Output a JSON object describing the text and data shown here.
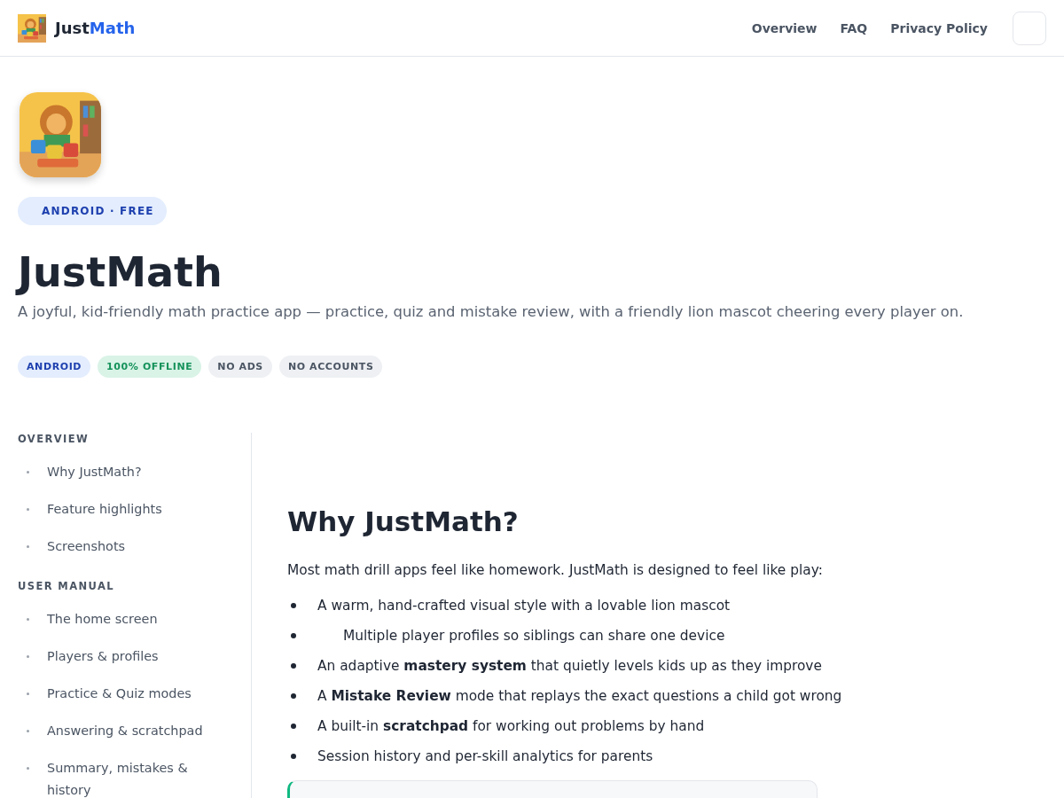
{
  "header": {
    "brand": {
      "first": "Just",
      "second": "Math"
    },
    "nav": [
      {
        "label": "Overview"
      },
      {
        "label": "FAQ"
      },
      {
        "label": "Privacy Policy"
      }
    ]
  },
  "hero": {
    "badge": "ANDROID · FREE",
    "title": "JustMath",
    "subtitle": "A joyful, kid-friendly math practice app — practice, quiz and mistake review, with a friendly lion mascot cheering every player on.",
    "tags": [
      {
        "label": "ANDROID",
        "kind": "primary"
      },
      {
        "label": "100% OFFLINE",
        "kind": "success"
      },
      {
        "label": "NO ADS",
        "kind": "neutral"
      },
      {
        "label": "NO ACCOUNTS",
        "kind": "neutral"
      }
    ]
  },
  "sidebar": {
    "sections": [
      {
        "title": "OVERVIEW",
        "items": [
          {
            "label": "Why JustMath?"
          },
          {
            "label": "Feature highlights"
          },
          {
            "label": "Screenshots"
          }
        ]
      },
      {
        "title": "USER MANUAL",
        "items": [
          {
            "label": "The home screen"
          },
          {
            "label": "Players & profiles"
          },
          {
            "label": "Practice & Quiz modes"
          },
          {
            "label": "Answering & scratchpad"
          },
          {
            "label": "Summary, mistakes & history"
          }
        ]
      }
    ]
  },
  "content": {
    "heading": "Why JustMath?",
    "intro": "Most math drill apps feel like homework. JustMath is designed to feel like play:",
    "bullets": [
      {
        "text": "A warm, hand-crafted visual style with a lovable lion mascot",
        "indented": false
      },
      {
        "text": "Multiple player profiles so siblings can share one device",
        "indented": true
      },
      {
        "text": "An adaptive **mastery system** that quietly levels kids up as they improve",
        "indented": false
      },
      {
        "text": "A **Mistake Review** mode that replays the exact questions a child got wrong",
        "indented": false
      },
      {
        "text": "A built-in **scratchpad** for working out problems by hand",
        "indented": false
      },
      {
        "text": "Session history and per-skill analytics for parents",
        "indented": false
      }
    ]
  }
}
